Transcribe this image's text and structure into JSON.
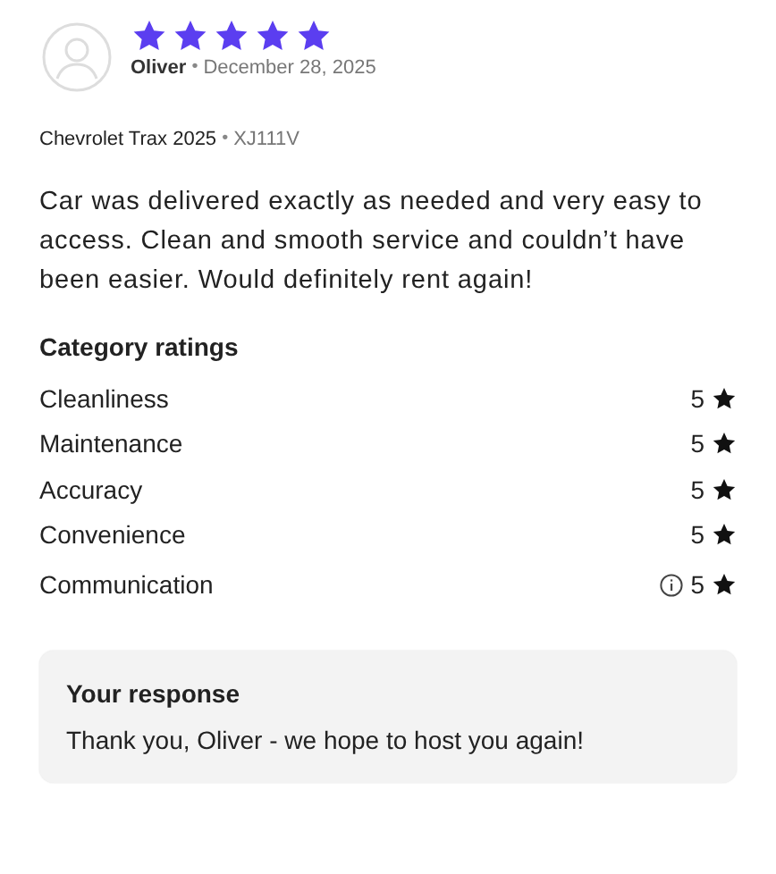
{
  "review": {
    "stars": 5,
    "author": "Oliver",
    "separator": "•",
    "date": "December 28, 2025",
    "car": "Chevrolet Trax 2025",
    "car_separator": "•",
    "plate": "XJ111V",
    "text": "Car was delivered exactly as needed and very easy to access. Clean and smooth service and couldn’t have been easier. Would definitely rent again!"
  },
  "category_ratings": {
    "title": "Category ratings",
    "items": [
      {
        "name": "Cleanliness",
        "score": "5",
        "info": false
      },
      {
        "name": "Maintenance",
        "score": "5",
        "info": false
      },
      {
        "name": "Accuracy",
        "score": "5",
        "info": false
      },
      {
        "name": "Convenience",
        "score": "5",
        "info": false
      },
      {
        "name": "Communication",
        "score": "5",
        "info": true
      }
    ]
  },
  "response": {
    "title": "Your response",
    "text": "Thank you, Oliver - we hope to host you again!"
  }
}
